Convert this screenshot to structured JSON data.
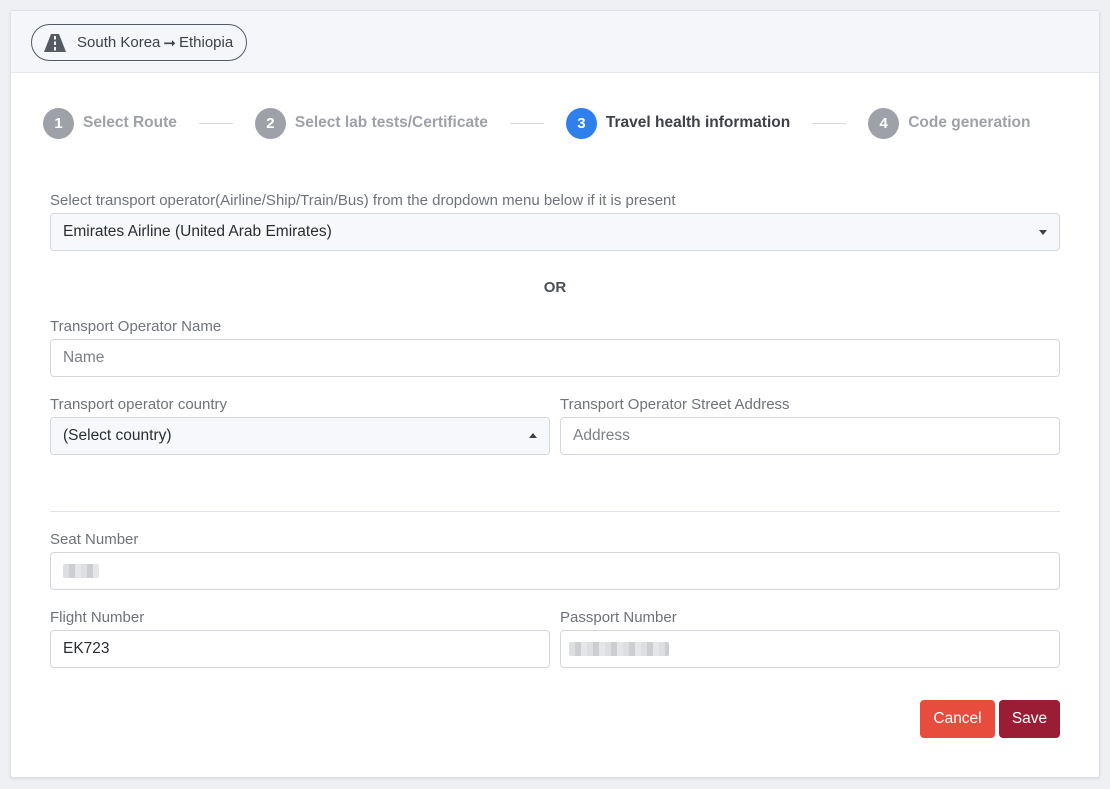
{
  "header": {
    "route_from": "South Korea",
    "route_arrow": "➞",
    "route_to": "Ethiopia",
    "route_icon": "road-icon"
  },
  "stepper": {
    "steps": [
      {
        "num": "1",
        "label": "Select Route",
        "active": false
      },
      {
        "num": "2",
        "label": "Select lab tests/Certificate",
        "active": false
      },
      {
        "num": "3",
        "label": "Travel health information",
        "active": true
      },
      {
        "num": "4",
        "label": "Code generation",
        "active": false
      }
    ],
    "active_color": "#2f80ed",
    "inactive_color": "#9ea2a8"
  },
  "form": {
    "operator_select_label": "Select transport operator(Airline/Ship/Train/Bus) from the dropdown menu below if it is present",
    "operator_select_value": "Emirates Airline (United Arab Emirates)",
    "or_text": "OR",
    "operator_name_label": "Transport Operator Name",
    "operator_name_placeholder": "Name",
    "operator_country_label": "Transport operator country",
    "operator_country_value": "(Select country)",
    "operator_address_label": "Transport Operator Street Address",
    "operator_address_placeholder": "Address",
    "seat_number_label": "Seat Number",
    "flight_number_label": "Flight Number",
    "flight_number_value": "EK723",
    "passport_number_label": "Passport Number"
  },
  "actions": {
    "cancel_label": "Cancel",
    "save_label": "Save",
    "cancel_color": "#e74c3c",
    "save_color": "#9b1d35"
  }
}
